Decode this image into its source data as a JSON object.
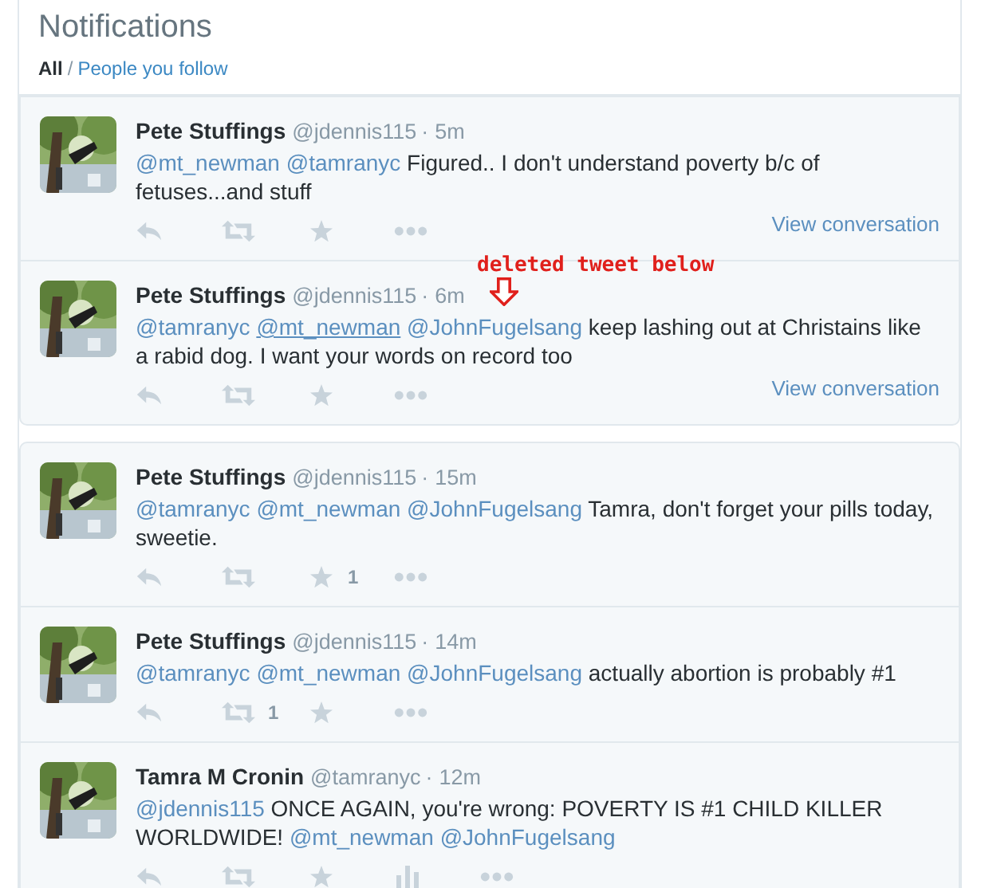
{
  "header": {
    "title": "Notifications",
    "separator": "/",
    "filters": [
      {
        "label": "All",
        "selected": true
      },
      {
        "label": "People you follow",
        "selected": false
      }
    ]
  },
  "groups": [
    {
      "tweets": [
        {
          "name": "Pete Stuffings",
          "handle": "@jdennis115",
          "separator": "·",
          "time": "5m",
          "parts": [
            {
              "kind": "mention",
              "text": "@mt_newman",
              "underlined": false
            },
            {
              "kind": "mention",
              "text": "@tamranyc",
              "underlined": false
            },
            {
              "kind": "text",
              "text": "Figured.. I don't understand poverty b/c of fetuses...and stuff"
            }
          ],
          "actions": [
            {
              "kind": "reply"
            },
            {
              "kind": "retweet"
            },
            {
              "kind": "favorite"
            },
            {
              "kind": "more"
            }
          ],
          "link": "View conversation"
        },
        {
          "name": "Pete Stuffings",
          "handle": "@jdennis115",
          "separator": "·",
          "time": "6m",
          "parts": [
            {
              "kind": "mention",
              "text": "@tamranyc",
              "underlined": false
            },
            {
              "kind": "mention",
              "text": "@mt_newman",
              "underlined": true
            },
            {
              "kind": "mention",
              "text": "@JohnFugelsang",
              "underlined": false
            },
            {
              "kind": "text",
              "text": "keep lashing out at Christains like a rabid dog.  I want your words on record too"
            }
          ],
          "actions": [
            {
              "kind": "reply"
            },
            {
              "kind": "retweet"
            },
            {
              "kind": "favorite"
            },
            {
              "kind": "more"
            }
          ],
          "link": "View conversation",
          "annotation": {
            "text": "deleted tweet below"
          }
        }
      ]
    },
    {
      "tweets": [
        {
          "name": "Pete Stuffings",
          "handle": "@jdennis115",
          "separator": "·",
          "time": "15m",
          "parts": [
            {
              "kind": "mention",
              "text": "@tamranyc",
              "underlined": false
            },
            {
              "kind": "mention",
              "text": "@mt_newman",
              "underlined": false
            },
            {
              "kind": "mention",
              "text": "@JohnFugelsang",
              "underlined": false
            },
            {
              "kind": "text",
              "text": "Tamra, don't forget your pills today, sweetie."
            }
          ],
          "actions": [
            {
              "kind": "reply"
            },
            {
              "kind": "retweet"
            },
            {
              "kind": "favorite",
              "count": "1"
            },
            {
              "kind": "more"
            }
          ]
        },
        {
          "name": "Pete Stuffings",
          "handle": "@jdennis115",
          "separator": "·",
          "time": "14m",
          "parts": [
            {
              "kind": "mention",
              "text": "@tamranyc",
              "underlined": false
            },
            {
              "kind": "mention",
              "text": "@mt_newman",
              "underlined": false
            },
            {
              "kind": "mention",
              "text": "@JohnFugelsang",
              "underlined": false
            },
            {
              "kind": "text",
              "text": "actually abortion is probably #1"
            }
          ],
          "actions": [
            {
              "kind": "reply"
            },
            {
              "kind": "retweet",
              "count": "1"
            },
            {
              "kind": "favorite"
            },
            {
              "kind": "more"
            }
          ]
        },
        {
          "name": "Tamra M Cronin",
          "handle": "@tamranyc",
          "separator": "·",
          "time": "12m",
          "parts": [
            {
              "kind": "mention",
              "text": "@jdennis115",
              "underlined": false
            },
            {
              "kind": "text",
              "text": "ONCE AGAIN, you're wrong: POVERTY IS #1 CHILD KILLER WORLDWIDE!"
            },
            {
              "kind": "mention",
              "text": "@mt_newman",
              "underlined": false
            },
            {
              "kind": "mention",
              "text": "@JohnFugelsang",
              "underlined": false
            }
          ],
          "actions": [
            {
              "kind": "reply"
            },
            {
              "kind": "retweet"
            },
            {
              "kind": "favorite"
            },
            {
              "kind": "analytics"
            },
            {
              "kind": "more"
            }
          ]
        }
      ]
    }
  ]
}
